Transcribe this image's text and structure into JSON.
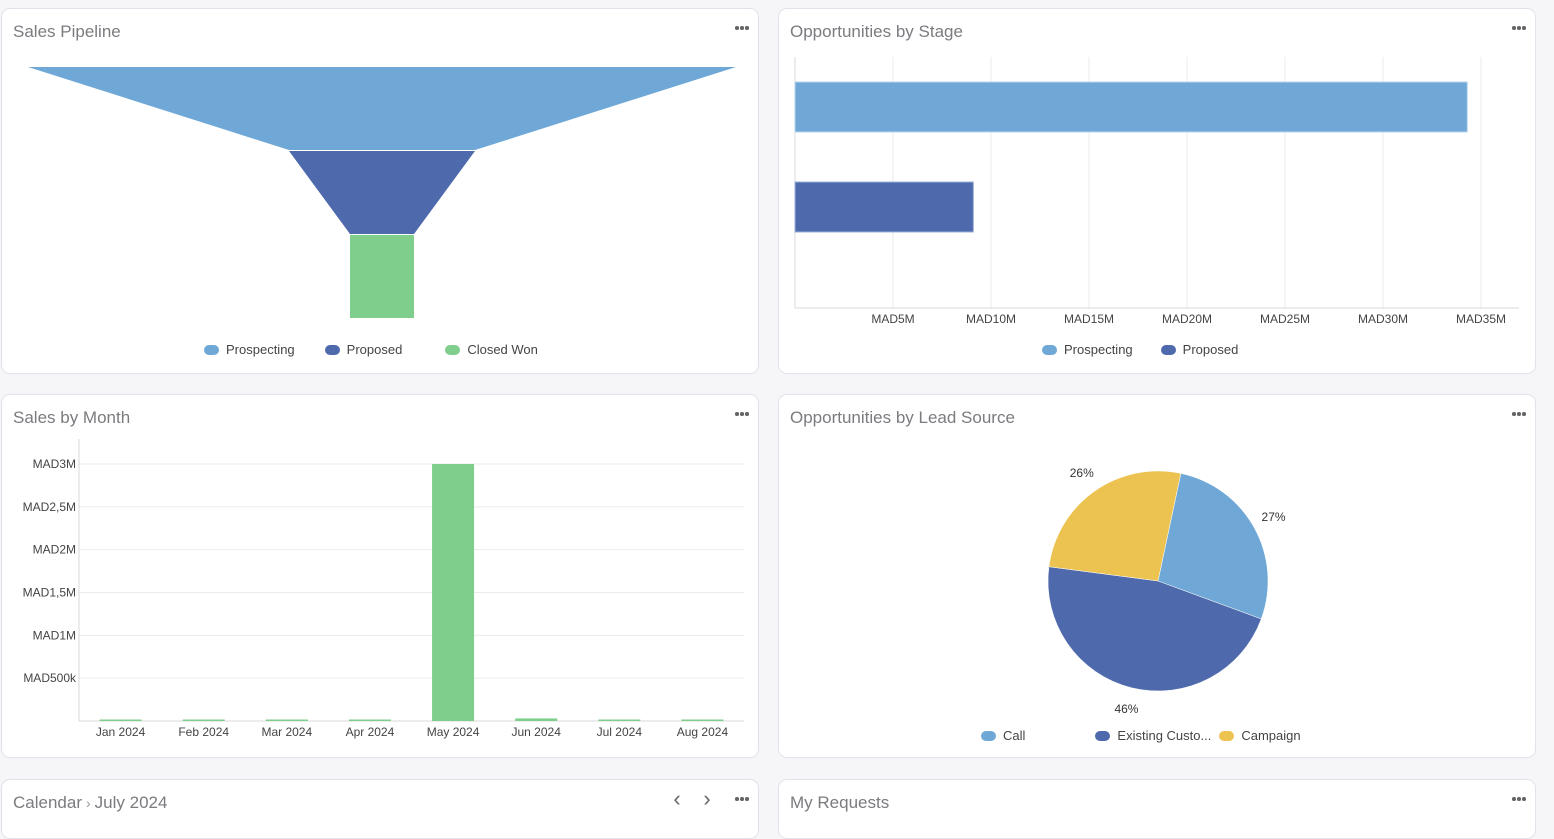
{
  "colors": {
    "light_blue": "#6fa8d6",
    "dark_blue": "#4e6aad",
    "green": "#80ce8c",
    "yellow": "#ecc351",
    "grid": "#ebebeb",
    "axis": "#d8d8d8"
  },
  "panels": {
    "pipeline": {
      "title": "Sales Pipeline"
    },
    "stage": {
      "title": "Opportunities by Stage"
    },
    "month": {
      "title": "Sales by Month"
    },
    "lead": {
      "title": "Opportunities by Lead Source"
    },
    "calendar": {
      "title": "Calendar",
      "separator": "›",
      "subtitle": "July 2024",
      "prev": "‹",
      "next": "›"
    },
    "requests": {
      "title": "My Requests"
    }
  },
  "chart_data": [
    {
      "id": "sales-pipeline",
      "type": "funnel",
      "title": "Sales Pipeline",
      "categories": [
        "Prospecting",
        "Proposed",
        "Closed Won"
      ],
      "values": [
        34300000,
        9100000,
        3000000
      ],
      "legend": [
        {
          "label": "Prospecting",
          "color": "#6fa8d6"
        },
        {
          "label": "Proposed",
          "color": "#4e6aad"
        },
        {
          "label": "Closed Won",
          "color": "#80ce8c"
        }
      ],
      "legend_position": "bottom"
    },
    {
      "id": "opportunities-by-stage",
      "type": "bar",
      "orientation": "horizontal",
      "title": "Opportunities by Stage",
      "categories": [
        "Prospecting",
        "Proposed"
      ],
      "values": [
        34300000,
        9100000
      ],
      "xlim": [
        0,
        37000000
      ],
      "xticks": [
        5000000,
        10000000,
        15000000,
        20000000,
        25000000,
        30000000,
        35000000
      ],
      "xtick_labels": [
        "MAD5M",
        "MAD10M",
        "MAD15M",
        "MAD20M",
        "MAD25M",
        "MAD30M",
        "MAD35M"
      ],
      "grid": true,
      "legend": [
        {
          "label": "Prospecting",
          "color": "#6fa8d6"
        },
        {
          "label": "Proposed",
          "color": "#4e6aad"
        }
      ],
      "legend_position": "bottom"
    },
    {
      "id": "sales-by-month",
      "type": "bar",
      "title": "Sales by Month",
      "categories": [
        "Jan 2024",
        "Feb 2024",
        "Mar 2024",
        "Apr 2024",
        "May 2024",
        "Jun 2024",
        "Jul 2024",
        "Aug 2024"
      ],
      "values": [
        5000,
        5000,
        5000,
        5000,
        3000000,
        30000,
        5000,
        5000
      ],
      "ylim": [
        0,
        3000000
      ],
      "yticks": [
        500000,
        1000000,
        1500000,
        2000000,
        2500000,
        3000000
      ],
      "ytick_labels": [
        "MAD500k",
        "MAD1M",
        "MAD1,5M",
        "MAD2M",
        "MAD2,5M",
        "MAD3M"
      ],
      "grid": true,
      "color": "#80ce8c"
    },
    {
      "id": "opportunities-by-lead-source",
      "type": "pie",
      "title": "Opportunities by Lead Source",
      "slices": [
        {
          "label": "Call",
          "value": 27,
          "display": "27%",
          "color": "#6fa8d6"
        },
        {
          "label": "Existing Customer",
          "legend_label": "Existing Custo...",
          "value": 46,
          "display": "46%",
          "color": "#4e6aad"
        },
        {
          "label": "Campaign",
          "value": 26,
          "display": "26%",
          "color": "#ecc351"
        }
      ],
      "legend_position": "bottom"
    }
  ]
}
